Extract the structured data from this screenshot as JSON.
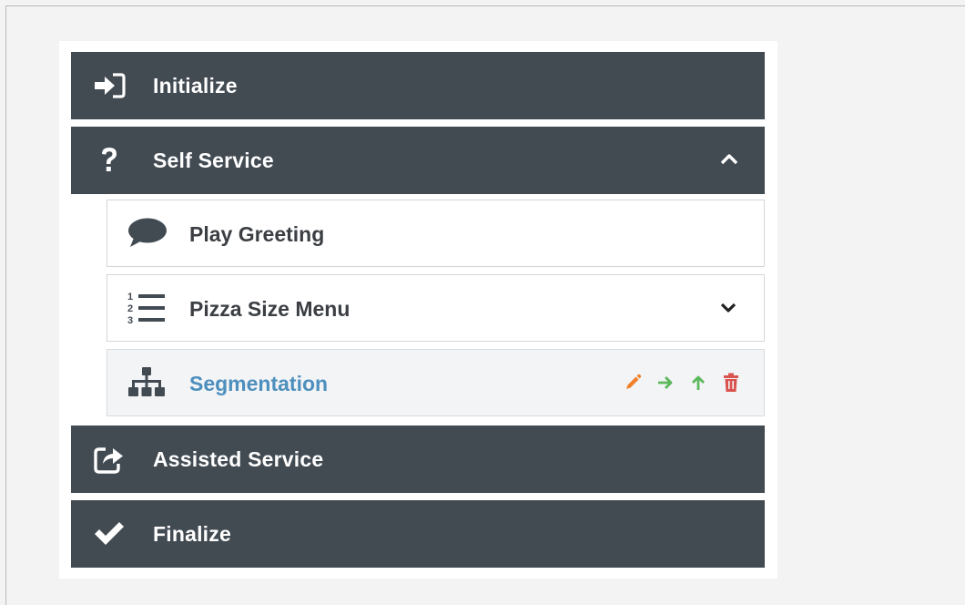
{
  "workflow": {
    "phases": {
      "initialize": {
        "label": "Initialize",
        "icon": "sign-in-icon"
      },
      "self_service": {
        "label": "Self Service",
        "icon": "question-icon",
        "expanded": true
      },
      "assisted_service": {
        "label": "Assisted Service",
        "icon": "share-icon"
      },
      "finalize": {
        "label": "Finalize",
        "icon": "check-icon"
      }
    },
    "blocks": {
      "play_greeting": {
        "label": "Play Greeting",
        "icon": "speech-bubble-icon"
      },
      "pizza_size_menu": {
        "label": "Pizza Size Menu",
        "icon": "ordered-list-icon",
        "collapsed": true
      },
      "segmentation": {
        "label": "Segmentation",
        "icon": "sitemap-icon",
        "selected": true
      }
    },
    "block_actions": {
      "edit": {
        "icon": "pencil-icon",
        "color": "#f0812a"
      },
      "move_right": {
        "icon": "arrow-right-icon",
        "color": "#5cb85c"
      },
      "move_up": {
        "icon": "arrow-up-icon",
        "color": "#5cb85c"
      },
      "delete": {
        "icon": "trash-icon",
        "color": "#d9534f"
      }
    }
  },
  "colors": {
    "phase_background": "#424a52",
    "selected_label": "#4d8fbd",
    "block_label": "#3b3f44"
  }
}
